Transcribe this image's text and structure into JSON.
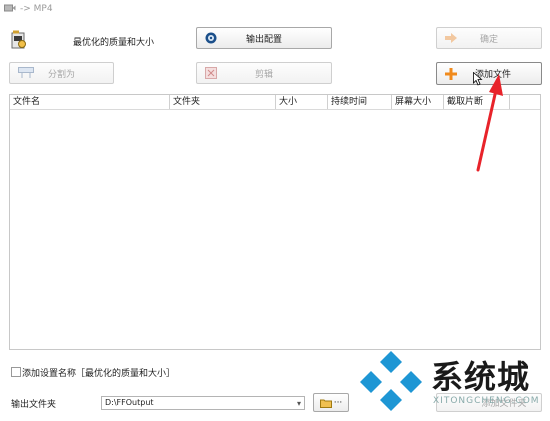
{
  "window": {
    "title": "-> MP4"
  },
  "profile": {
    "label": "最优化的质量和大小"
  },
  "toolbar": {
    "output_config": "输出配置",
    "ok": "确定",
    "split": "分割为",
    "clip": "剪辑",
    "add_file": "添加文件"
  },
  "table": {
    "columns": [
      "文件名",
      "文件夹",
      "大小",
      "持续时间",
      "屏幕大小",
      "截取片断"
    ]
  },
  "bottom": {
    "append_setting_label": "添加设置名称［最优化的质量和大小］",
    "output_folder_label": "输出文件夹",
    "output_folder_value": "D:\\FFOutput",
    "browse_dots": "···",
    "add_folder": "添加文件夹"
  },
  "watermark": {
    "text": "系统城",
    "sub": "XITONGCHENG.COM"
  },
  "colors": {
    "annotation_arrow": "#e8232a",
    "accent_orange": "#f08a1c",
    "watermark_blue": "#1e96d4"
  }
}
